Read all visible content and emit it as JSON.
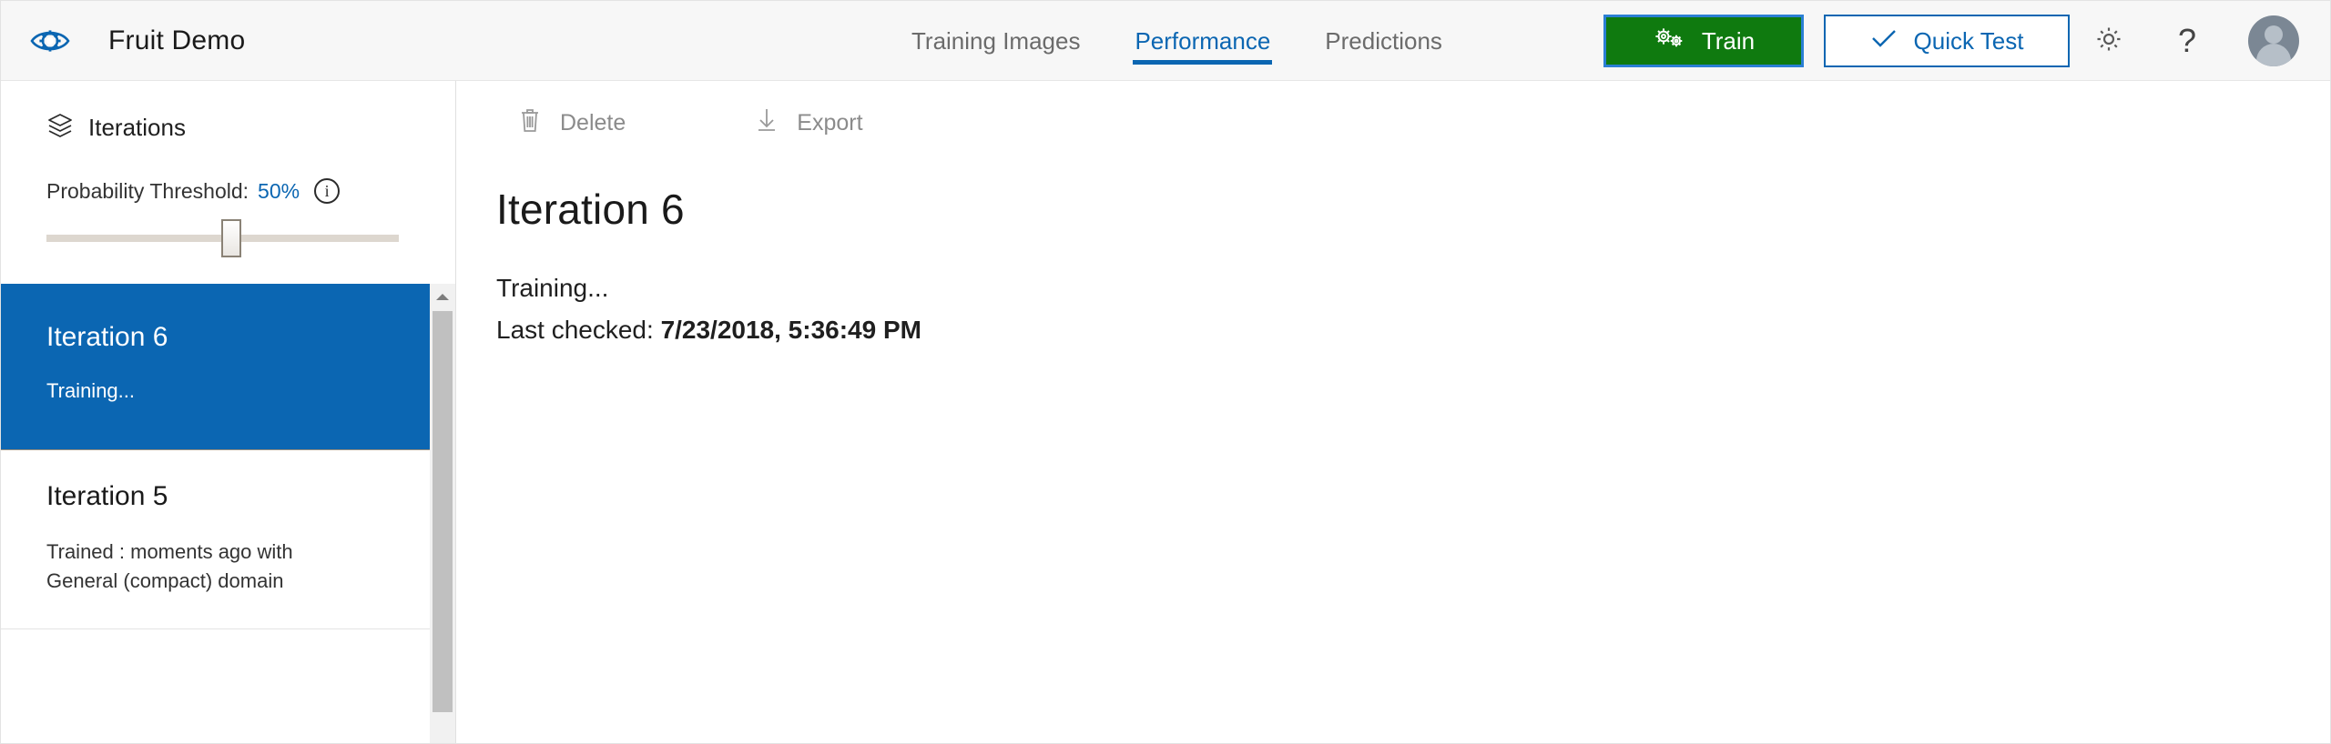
{
  "header": {
    "logo_icon": "eye-gear-logo-icon",
    "title": "Fruit Demo",
    "tabs": [
      {
        "label": "Training Images",
        "active": false
      },
      {
        "label": "Performance",
        "active": true
      },
      {
        "label": "Predictions",
        "active": false
      }
    ],
    "train_button": {
      "label": "Train",
      "icon": "gears-icon",
      "color": "#0f7a0f",
      "focus_border": "#2b7fd4"
    },
    "quick_test_button": {
      "label": "Quick Test",
      "icon": "checkmark-icon",
      "color": "#0b66b2"
    },
    "settings_icon": "gear-icon",
    "help_icon": "question-mark-icon",
    "avatar": "user-avatar-icon"
  },
  "sidebar": {
    "section_title": "Iterations",
    "section_icon": "layers-stack-icon",
    "threshold": {
      "label": "Probability Threshold:",
      "value": "50%",
      "info_icon": "info-icon",
      "info_glyph": "i",
      "slider_position_percent": 48,
      "accent_color": "#0b66b2"
    },
    "iterations": [
      {
        "title": "Iteration 6",
        "subtitle": "Training...",
        "selected": true
      },
      {
        "title": "Iteration 5",
        "subtitle": "Trained : moments ago with General (compact) domain",
        "selected": false
      }
    ],
    "scrollbar": {
      "up_arrow_icon": "scroll-up-arrow-icon"
    }
  },
  "toolbar": {
    "delete_label": "Delete",
    "delete_icon": "trash-icon",
    "export_label": "Export",
    "export_icon": "download-arrow-icon"
  },
  "main": {
    "page_title": "Iteration 6",
    "status": "Training...",
    "last_checked_label": "Last checked:",
    "last_checked_value": "7/23/2018, 5:36:49 PM"
  }
}
